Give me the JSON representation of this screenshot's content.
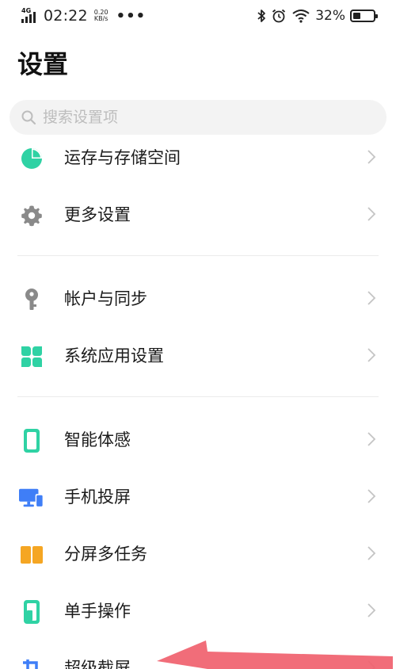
{
  "status_bar": {
    "network": "4G",
    "time": "02:22",
    "speed_value": "0.20",
    "speed_unit": "KB/s",
    "more": "•••",
    "battery_percent": "32%",
    "battery_level": 0.32
  },
  "page": {
    "title": "设置"
  },
  "search": {
    "placeholder": "搜索设置项"
  },
  "groups": [
    [
      {
        "label": "运存与存储空间",
        "icon": "storage-pie-icon",
        "color": "#2fd2a4"
      },
      {
        "label": "更多设置",
        "icon": "gear-icon",
        "color": "#888888"
      }
    ],
    [
      {
        "label": "帐户与同步",
        "icon": "key-icon",
        "color": "#8a8a8a"
      },
      {
        "label": "系统应用设置",
        "icon": "four-petal-icon",
        "color": "#2fd2a4"
      }
    ],
    [
      {
        "label": "智能体感",
        "icon": "phone-motion-icon",
        "color": "#2fd2a4"
      },
      {
        "label": "手机投屏",
        "icon": "screen-cast-icon",
        "color": "#3f7ef7"
      },
      {
        "label": "分屏多任务",
        "icon": "split-screen-icon",
        "color": "#f5a623"
      },
      {
        "label": "单手操作",
        "icon": "one-hand-icon",
        "color": "#2fd2a4"
      },
      {
        "label": "超级截屏",
        "icon": "screenshot-icon",
        "color": "#3f7ef7"
      }
    ]
  ],
  "colors": {
    "accent_green": "#2fd2a4",
    "accent_blue": "#3f7ef7",
    "accent_orange": "#f5a623",
    "arrow_red": "#f0616e"
  }
}
